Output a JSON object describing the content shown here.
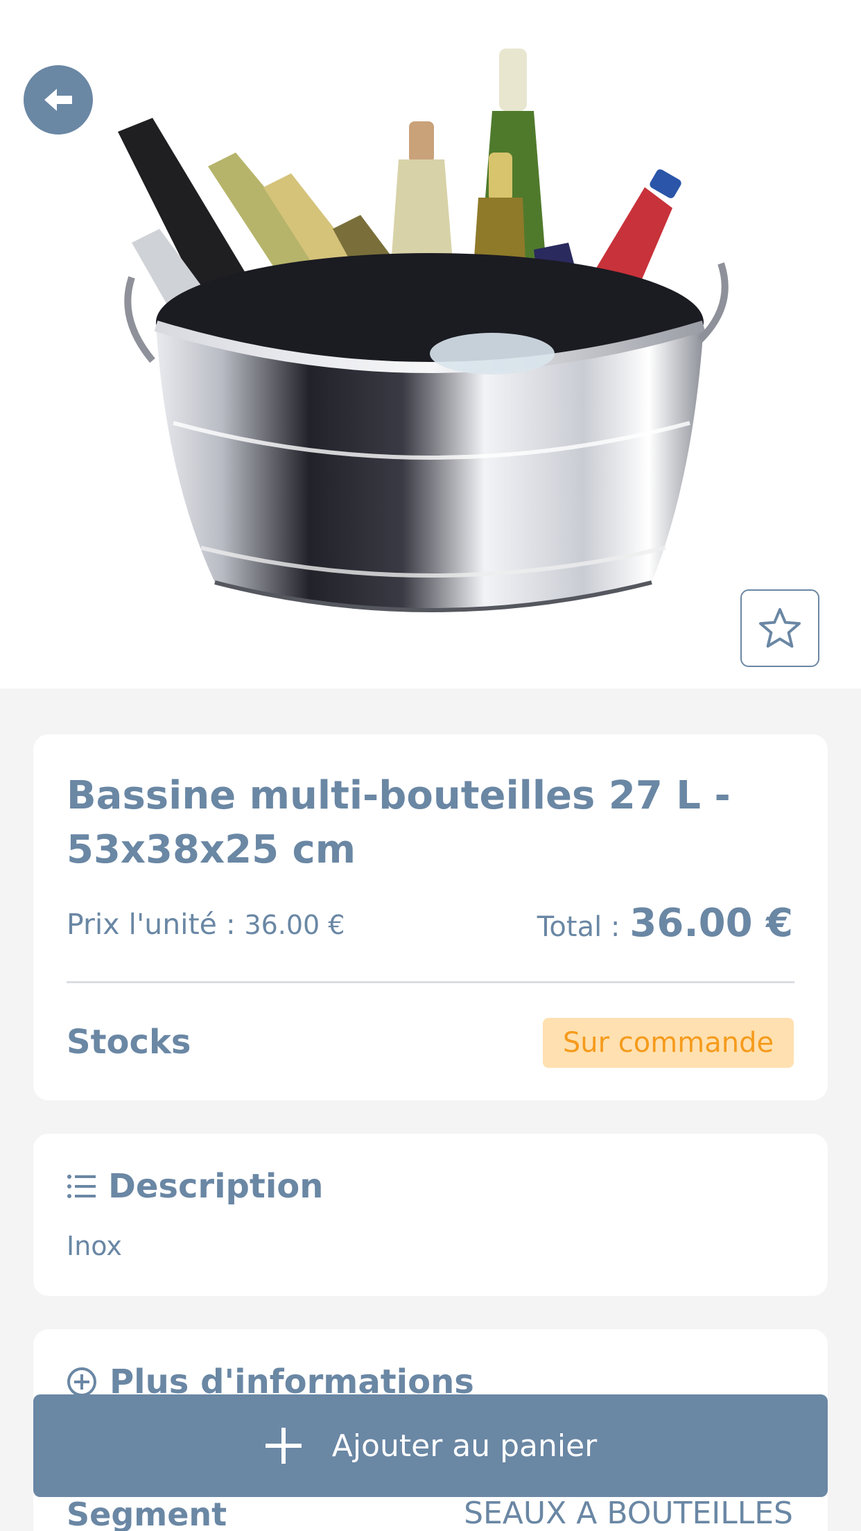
{
  "header": {
    "back_icon": "arrow-left-icon",
    "favorite_icon": "star-outline-icon"
  },
  "product": {
    "title": "Bassine multi-bouteilles 27 L - 53x38x25 cm",
    "unit_price_label": "Prix l'unité :",
    "unit_price_value": "36.00 €",
    "total_label": "Total :",
    "total_value": "36.00 €",
    "stocks_label": "Stocks",
    "stock_status": "Sur commande"
  },
  "description": {
    "heading": "Description",
    "icon": "list-icon",
    "text": "Inox"
  },
  "more_info": {
    "heading": "Plus d'informations",
    "icon": "plus-circle-icon",
    "segment_label": "Segment",
    "segment_value": "SEAUX A BOUTEILLES"
  },
  "actions": {
    "add_to_cart_label": "Ajouter au panier",
    "add_icon": "plus-icon"
  },
  "colors": {
    "primary": "#6a87a4",
    "badge_bg": "#ffe0b0",
    "badge_text": "#f59b1c",
    "page_bg": "#f4f4f4"
  }
}
